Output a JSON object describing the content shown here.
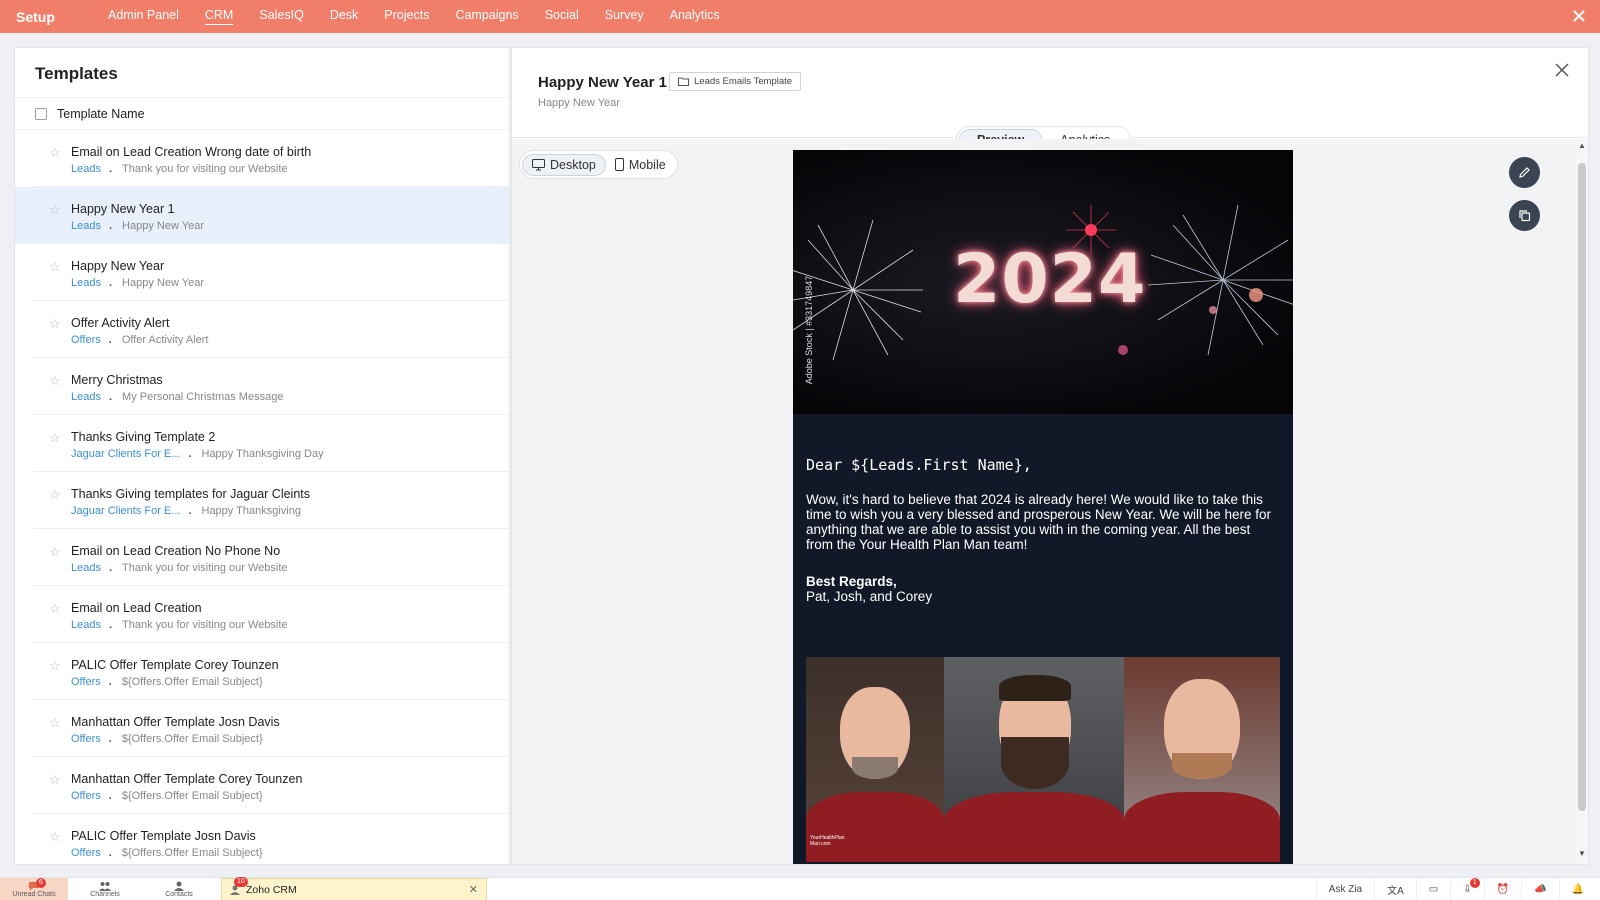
{
  "topbar": {
    "setup": "Setup",
    "nav": [
      "Admin Panel",
      "CRM",
      "SalesIQ",
      "Desk",
      "Projects",
      "Campaigns",
      "Social",
      "Survey",
      "Analytics"
    ],
    "active": "CRM"
  },
  "templates": {
    "title": "Templates",
    "column_header": "Template Name",
    "rows": [
      {
        "name": "Email on Lead Creation Wrong date of birth",
        "module": "Leads",
        "subject": "Thank you for visiting our Website"
      },
      {
        "name": "Happy New Year 1",
        "module": "Leads",
        "subject": "Happy New Year",
        "selected": true
      },
      {
        "name": "Happy New Year",
        "module": "Leads",
        "subject": "Happy New Year"
      },
      {
        "name": "Offer Activity Alert",
        "module": "Offers",
        "subject": "Offer Activity Alert"
      },
      {
        "name": "Merry Christmas",
        "module": "Leads",
        "subject": "My Personal Christmas Message"
      },
      {
        "name": "Thanks Giving Template 2",
        "module": "Jaguar Clients For E...",
        "subject": "Happy Thanksgiving Day"
      },
      {
        "name": "Thanks Giving templates for Jaguar Cleints",
        "module": "Jaguar Clients For E...",
        "subject": "Happy Thanksgiving"
      },
      {
        "name": "Email on Lead Creation No Phone No",
        "module": "Leads",
        "subject": "Thank you for visiting our Website"
      },
      {
        "name": "Email on Lead Creation",
        "module": "Leads",
        "subject": "Thank you for visiting our Website"
      },
      {
        "name": "PALIC Offer Template Corey Tounzen",
        "module": "Offers",
        "subject": "${Offers.Offer Email Subject}"
      },
      {
        "name": "Manhattan Offer Template Josn Davis",
        "module": "Offers",
        "subject": "${Offers.Offer Email Subject}"
      },
      {
        "name": "Manhattan Offer Template Corey Tounzen",
        "module": "Offers",
        "subject": "${Offers.Offer Email Subject}"
      },
      {
        "name": "PALIC Offer Template Josn Davis",
        "module": "Offers",
        "subject": "${Offers.Offer Email Subject}"
      }
    ]
  },
  "detail": {
    "title": "Happy New Year 1",
    "folder_tag": "Leads Emails Template",
    "subject": "Happy New Year",
    "tabs": [
      "Preview",
      "Analytics"
    ],
    "active_tab": "Preview",
    "device_options": [
      "Desktop",
      "Mobile"
    ],
    "active_device": "Desktop"
  },
  "email": {
    "hero_text": "2024",
    "stock_watermark": "Adobe Stock | #331749847",
    "greeting": "Dear ${Leads.First Name},",
    "body": "Wow, it's hard to believe that 2024 is already here! We would like to take this time to wish you a very blessed and prosperous New Year. We will be here for anything that we are able to assist you with in the coming year. All the best from the Your Health Plan Man team!",
    "regards": "Best Regards,",
    "signers": "Pat, Josh, and Corey",
    "photo_logo": "YourHealthPlan Man.com"
  },
  "bottombar": {
    "unread_chats": "Unread Chats",
    "unread_badge": "6",
    "channels": "Channels",
    "contacts": "Contacts",
    "zoho_crm": "Zoho CRM",
    "zoho_badge": "10",
    "ask_zia": "Ask Zia",
    "notif_badge": "1"
  },
  "colors": {
    "topbar": "#f07e68",
    "link_blue": "#3a8fd6",
    "selected_row": "#e8f0fb",
    "email_bg": "#111827"
  }
}
